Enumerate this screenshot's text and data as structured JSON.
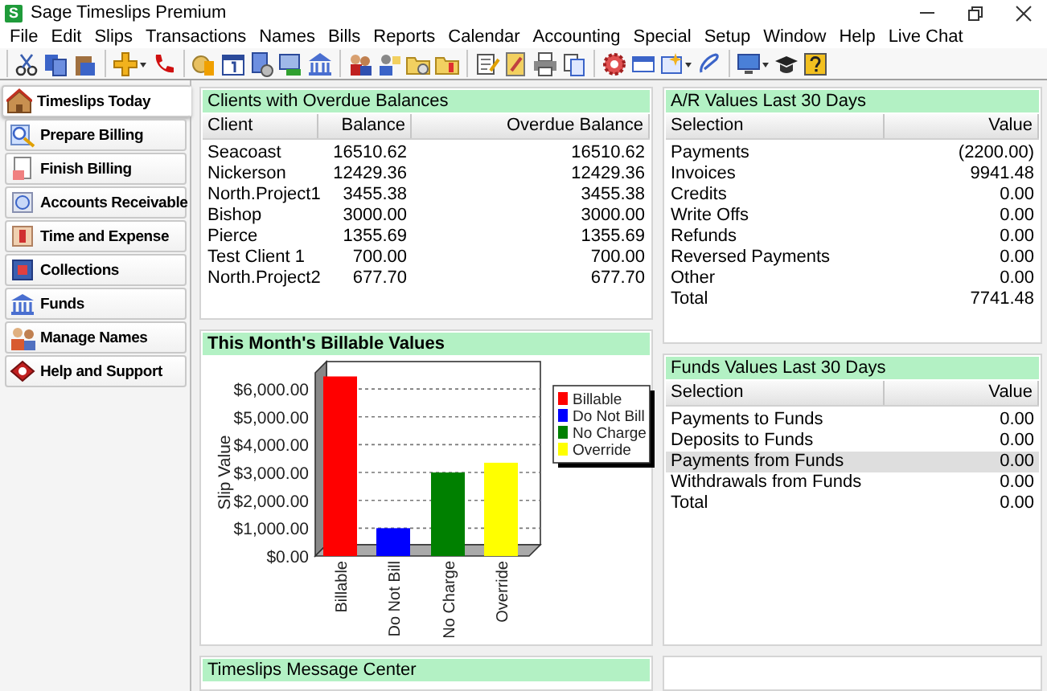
{
  "window": {
    "title": "Sage Timeslips Premium",
    "app_icon_letter": "S"
  },
  "menu": [
    "File",
    "Edit",
    "Slips",
    "Transactions",
    "Names",
    "Bills",
    "Reports",
    "Calendar",
    "Accounting",
    "Special",
    "Setup",
    "Window",
    "Help",
    "Live Chat"
  ],
  "sidebar": {
    "items": [
      {
        "label": "Timeslips Today",
        "selected": true
      },
      {
        "label": "Prepare Billing",
        "selected": false
      },
      {
        "label": "Finish Billing",
        "selected": false
      },
      {
        "label": "Accounts Receivable",
        "selected": false
      },
      {
        "label": "Time and Expense",
        "selected": false
      },
      {
        "label": "Collections",
        "selected": false
      },
      {
        "label": "Funds",
        "selected": false
      },
      {
        "label": "Manage Names",
        "selected": false
      },
      {
        "label": "Help and Support",
        "selected": false
      }
    ]
  },
  "panels": {
    "clients": {
      "title": "Clients with Overdue Balances",
      "columns": [
        "Client",
        "Balance",
        "Overdue Balance"
      ],
      "rows": [
        [
          "Seacoast",
          "16510.62",
          "16510.62"
        ],
        [
          "Nickerson",
          "12429.36",
          "12429.36"
        ],
        [
          "North.Project1",
          "3455.38",
          "3455.38"
        ],
        [
          "Bishop",
          "3000.00",
          "3000.00"
        ],
        [
          "Pierce",
          "1355.69",
          "1355.69"
        ],
        [
          "Test Client 1",
          "700.00",
          "700.00"
        ],
        [
          "North.Project2",
          "677.70",
          "677.70"
        ]
      ]
    },
    "ar": {
      "title": "A/R Values Last 30 Days",
      "columns": [
        "Selection",
        "Value"
      ],
      "rows": [
        [
          "Payments",
          "(2200.00)"
        ],
        [
          "Invoices",
          "9941.48"
        ],
        [
          "Credits",
          "0.00"
        ],
        [
          "Write Offs",
          "0.00"
        ],
        [
          "Refunds",
          "0.00"
        ],
        [
          "Reversed Payments",
          "0.00"
        ],
        [
          "Other",
          "0.00"
        ],
        [
          "Total",
          "7741.48"
        ]
      ]
    },
    "billable": {
      "title": "This Month's Billable Values",
      "chart_data": {
        "type": "bar",
        "ylabel": "Slip Value",
        "categories": [
          "Billable",
          "Do Not Bill",
          "No Charge",
          "Override"
        ],
        "series": [
          {
            "name": "Billable",
            "color": "#ff0000",
            "values": [
              6450,
              null,
              null,
              null
            ]
          },
          {
            "name": "Do Not Bill",
            "color": "#0000ff",
            "values": [
              null,
              1000,
              null,
              null
            ]
          },
          {
            "name": "No Charge",
            "color": "#008000",
            "values": [
              null,
              null,
              3000,
              null
            ]
          },
          {
            "name": "Override",
            "color": "#ffff00",
            "values": [
              null,
              null,
              null,
              3350
            ]
          }
        ],
        "ylim": [
          0,
          6580
        ],
        "grid": true,
        "legend": "right",
        "yticks": [
          {
            "value": 0,
            "label": "$0.00"
          },
          {
            "value": 1000,
            "label": "$1,000.00"
          },
          {
            "value": 2000,
            "label": "$2,000.00"
          },
          {
            "value": 3000,
            "label": "$3,000.00"
          },
          {
            "value": 4000,
            "label": "$4,000.00"
          },
          {
            "value": 5000,
            "label": "$5,000.00"
          },
          {
            "value": 6000,
            "label": "$6,000.00"
          }
        ]
      }
    },
    "funds": {
      "title": "Funds Values Last 30 Days",
      "columns": [
        "Selection",
        "Value"
      ],
      "rows": [
        {
          "cells": [
            "Payments to Funds",
            "0.00"
          ],
          "selected": false
        },
        {
          "cells": [
            "Deposits to Funds",
            "0.00"
          ],
          "selected": false
        },
        {
          "cells": [
            "Payments from Funds",
            "0.00"
          ],
          "selected": true
        },
        {
          "cells": [
            "Withdrawals from Funds",
            "0.00"
          ],
          "selected": false
        },
        {
          "cells": [
            "Total",
            "0.00"
          ],
          "selected": false
        }
      ]
    },
    "message_center": {
      "title": "Timeslips Message Center"
    }
  }
}
